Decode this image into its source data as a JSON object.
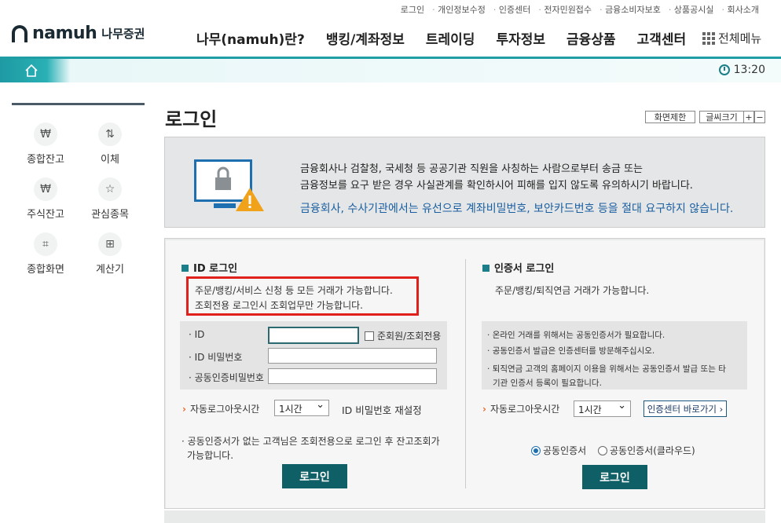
{
  "util_links": [
    "로그인",
    "개인정보수정",
    "인증센터",
    "전자민원접수",
    "금융소비자보호",
    "상품공시실",
    "회사소개"
  ],
  "logo": {
    "en": "namuh",
    "ko": "나무증권"
  },
  "gnb": [
    "나무(namuh)란?",
    "뱅킹/계좌정보",
    "트레이딩",
    "투자정보",
    "금융상품",
    "고객센터"
  ],
  "allmenu": "전체메뉴",
  "clock": "13:20",
  "quick": [
    {
      "label": "종합잔고",
      "icon": "₩"
    },
    {
      "label": "이체",
      "icon": "⇅"
    },
    {
      "label": "주식잔고",
      "icon": "₩"
    },
    {
      "label": "관심종목",
      "icon": "☆"
    },
    {
      "label": "종합화면",
      "icon": "⌗"
    },
    {
      "label": "계산기",
      "icon": "⊞"
    }
  ],
  "title": "로그인",
  "screen_limit": "화면제한",
  "font_size": "글씨크기",
  "notice": {
    "line1": "금융회사나 검찰청, 국세청 등 공공기관 직원을 사칭하는 사람으로부터 송금 또는",
    "line2": "금융정보를 요구 받은 경우 사실관계를 확인하시어 피해를 입지 않도록 유의하시기 바랍니다.",
    "line3": "금융회사, 수사기관에서는 유선으로 계좌비밀번호, 보안카드번호 등을 절대 요구하지 않습니다."
  },
  "id_login": {
    "heading": "ID 로그인",
    "desc1": "주문/뱅킹/서비스 신청 등 모든 거래가 가능합니다.",
    "desc2": "조회전용 로그인시 조회업무만 가능합니다.",
    "id_label": "ID",
    "member_check": "준회원/조회전용",
    "pw_label": "ID 비밀번호",
    "cert_pw_label": "공동인증비밀번호",
    "auto_logout": "자동로그아웃시간",
    "auto_value": "1시간",
    "reset_pw": "ID 비밀번호 재설정",
    "note1": "공동인증서가 없는 고객님은 조회전용으로 로그인 후 잔고조회가",
    "note2": "가능합니다.",
    "button": "로그인"
  },
  "cert_login": {
    "heading": "인증서 로그인",
    "desc": "주문/뱅킹/퇴직연금 거래가 가능합니다.",
    "b1": "온라인 거래를 위해서는 공동인증서가 필요합니다.",
    "b2": "공동인증서 발급은 인증센터를 방문해주십시오.",
    "b3a": "퇴직연금 고객의 홈페이지 이용을 위해서는 공동인증서 발급 또는 타",
    "b3b": "기관 인증서 등록이 필요합니다.",
    "auto_logout": "자동로그아웃시간",
    "auto_value": "1시간",
    "cert_center": "인증센터 바로가기",
    "radio1": "공동인증서",
    "radio2": "공동인증서(클라우드)",
    "button": "로그인"
  }
}
